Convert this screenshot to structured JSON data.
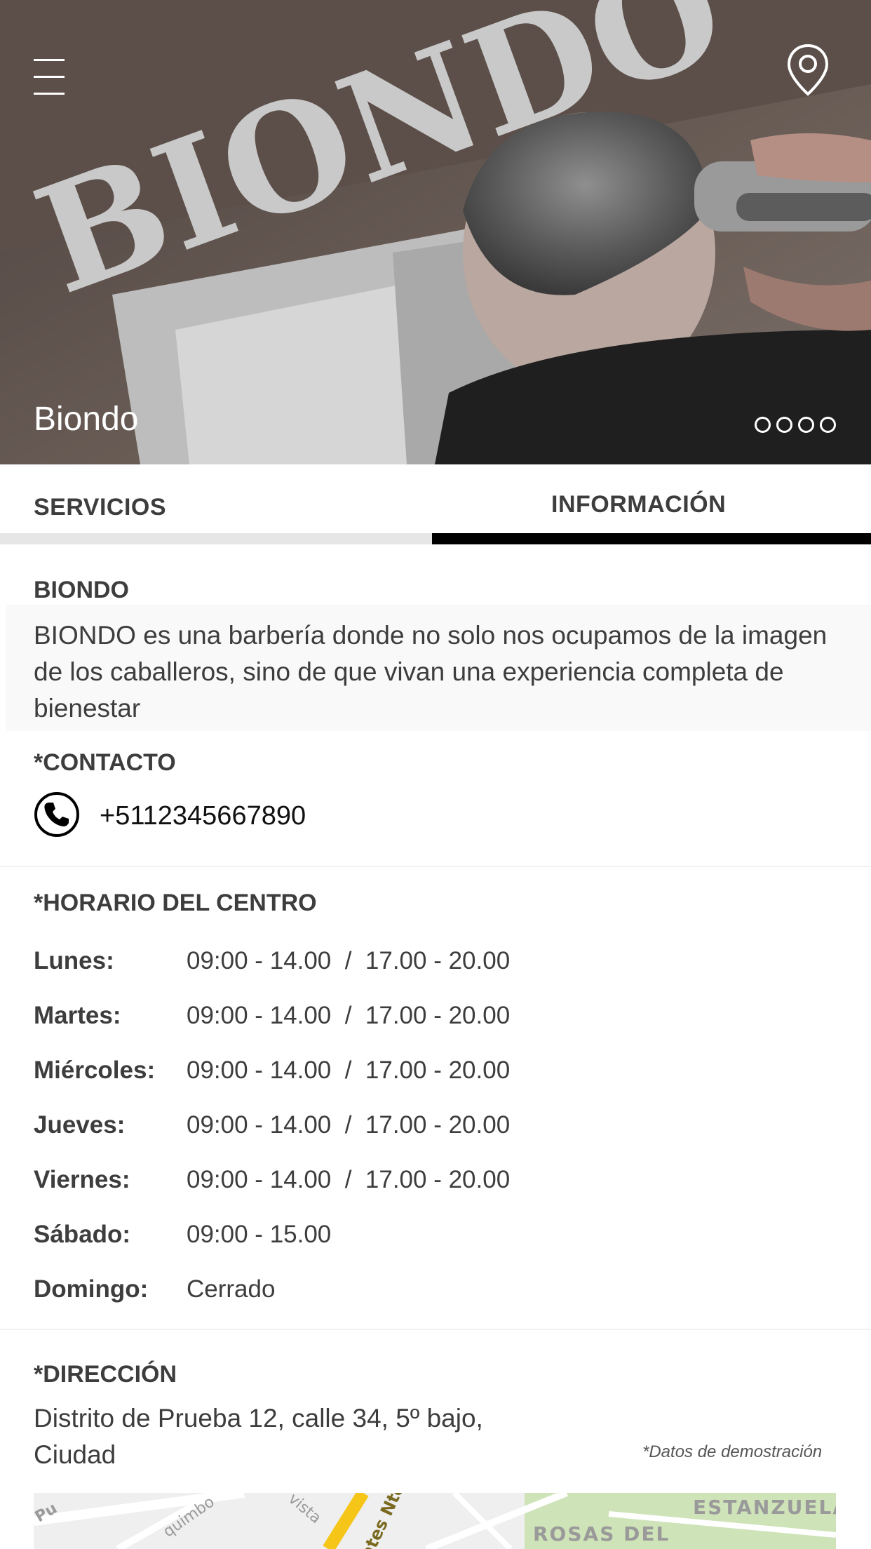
{
  "hero": {
    "title": "Biondo",
    "sign_text": "BIONDO",
    "dots_count": 4
  },
  "tabs": [
    {
      "label": "SERVICIOS",
      "active": false
    },
    {
      "label": "INFORMACIÓN",
      "active": true
    }
  ],
  "about": {
    "title": "BIONDO",
    "description": "BIONDO es una barbería donde no solo nos ocupamos de la imagen de los caballeros, sino de que vivan una experiencia completa de bienestar"
  },
  "contact": {
    "title": "*CONTACTO",
    "phone": "+5112345667890"
  },
  "hours": {
    "title": "*HORARIO DEL CENTRO",
    "rows": [
      {
        "day": "Lunes:",
        "time": "09:00 - 14.00  /  17.00 - 20.00"
      },
      {
        "day": "Martes:",
        "time": "09:00 - 14.00  /  17.00 - 20.00"
      },
      {
        "day": "Miércoles:",
        "time": "09:00 - 14.00  /  17.00 - 20.00"
      },
      {
        "day": "Jueves:",
        "time": "09:00 - 14.00  /  17.00 - 20.00"
      },
      {
        "day": "Viernes:",
        "time": "09:00 - 14.00  /  17.00 - 20.00"
      },
      {
        "day": "Sábado:",
        "time": "09:00 - 15.00"
      },
      {
        "day": "Domingo:",
        "time": "Cerrado"
      }
    ]
  },
  "address": {
    "title": "*DIRECCIÓN",
    "line1": "Distrito de Prueba 12, calle 34, 5º bajo,",
    "line2": "Ciudad",
    "demo_note": "*Datos de demostración"
  },
  "map": {
    "labels": [
      "ESTANZUELA",
      "ROSAS DEL",
      "Pu",
      "quimbo",
      "vista",
      "ntes Nte"
    ]
  },
  "colors": {
    "accent": "#000000",
    "text": "#3d3d3d",
    "tab_inactive_bar": "#e6e6e6",
    "map_road_yellow": "#f5c518",
    "map_green": "#cfe3b8"
  }
}
